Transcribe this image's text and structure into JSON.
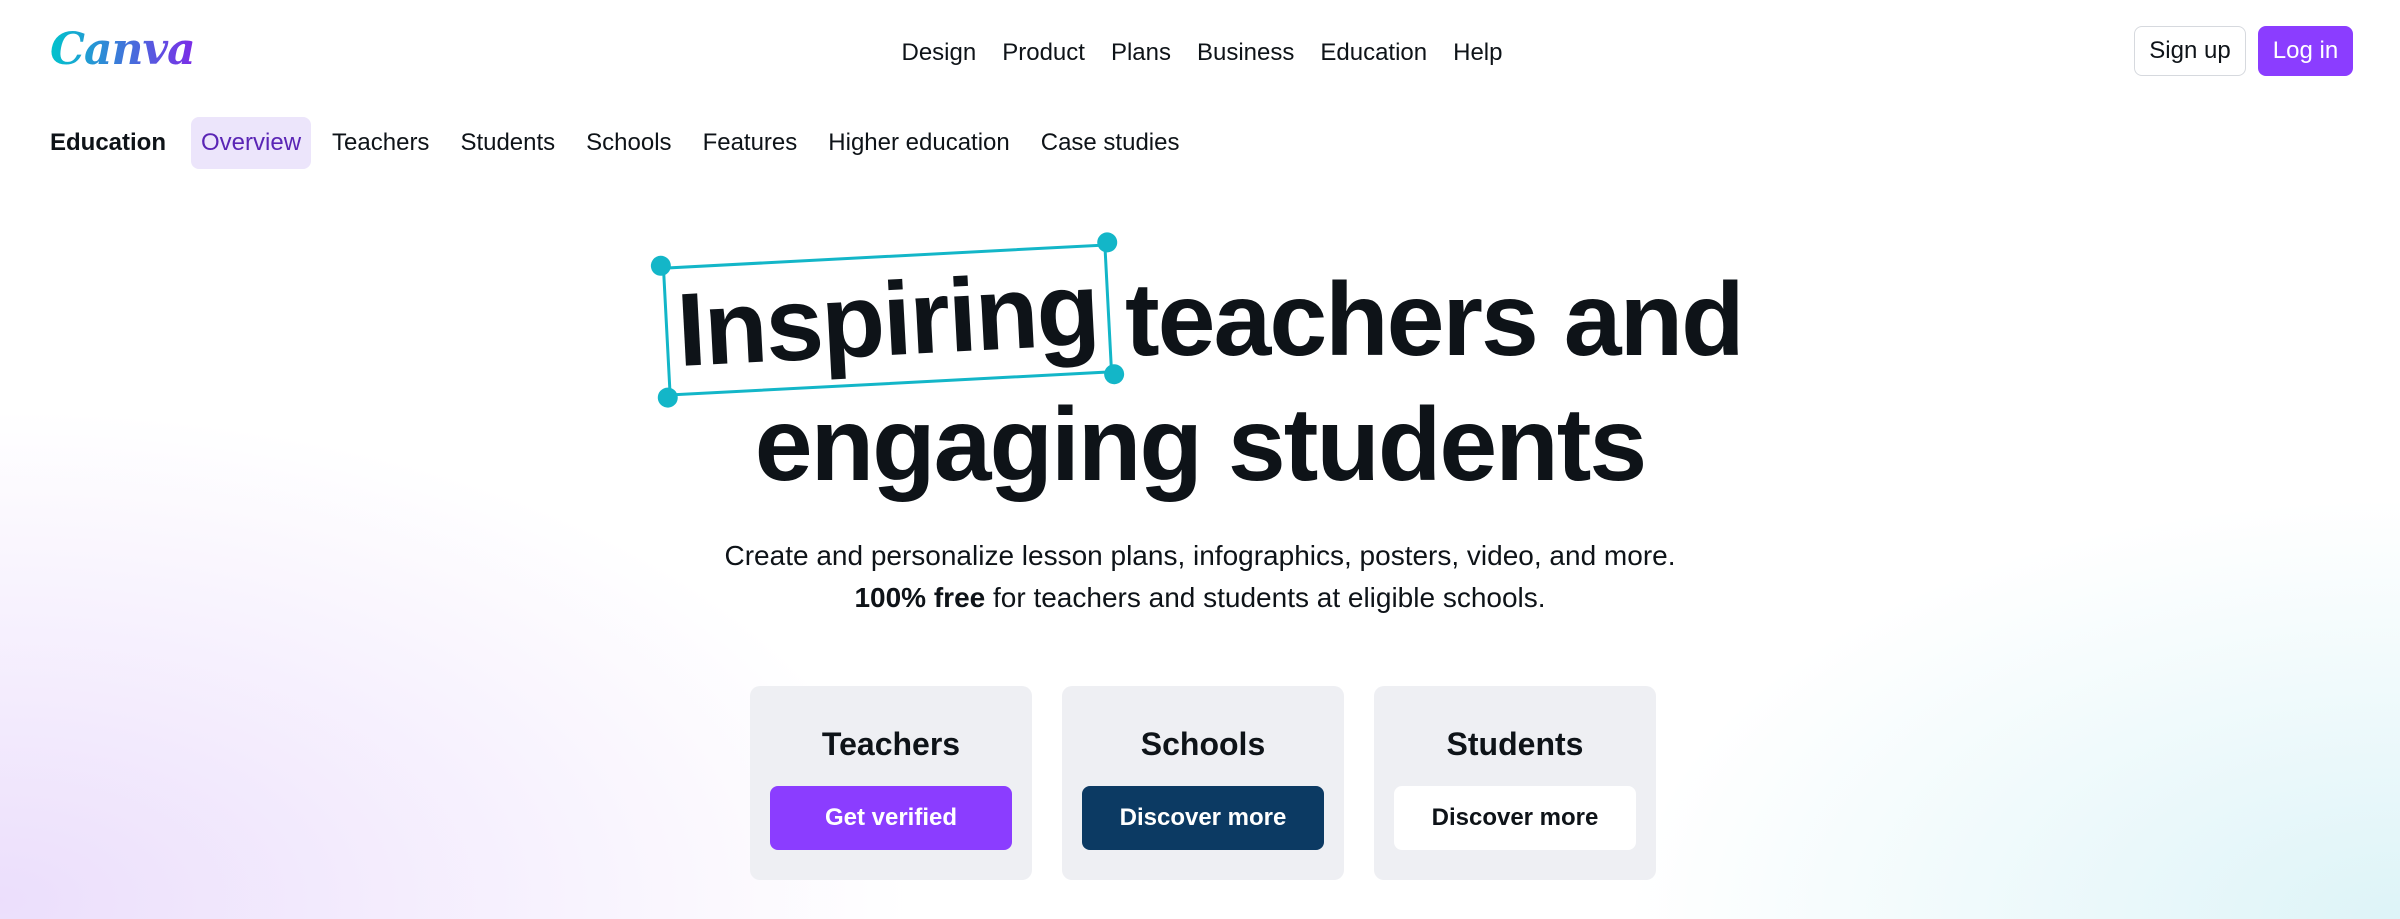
{
  "header": {
    "logo_text": "Canva",
    "nav": [
      "Design",
      "Product",
      "Plans",
      "Business",
      "Education",
      "Help"
    ],
    "signup_label": "Sign up",
    "login_label": "Log in"
  },
  "subnav": {
    "section": "Education",
    "items": [
      "Overview",
      "Teachers",
      "Students",
      "Schools",
      "Features",
      "Higher education",
      "Case studies"
    ],
    "active": "Overview"
  },
  "hero": {
    "highlight_word": "Inspiring",
    "line1_rest": "teachers and",
    "line2": "engaging students",
    "subtitle_line1": "Create and personalize lesson plans, infographics, posters, video, and more.",
    "subtitle_bold": "100% free",
    "subtitle_line2_rest": " for teachers and students at eligible schools."
  },
  "cards": [
    {
      "title": "Teachers",
      "button": "Get verified"
    },
    {
      "title": "Schools",
      "button": "Discover more"
    },
    {
      "title": "Students",
      "button": "Discover more"
    }
  ],
  "colors": {
    "brand_purple": "#8b3dff",
    "navy": "#0c3a63",
    "teal": "#13b6c8"
  }
}
